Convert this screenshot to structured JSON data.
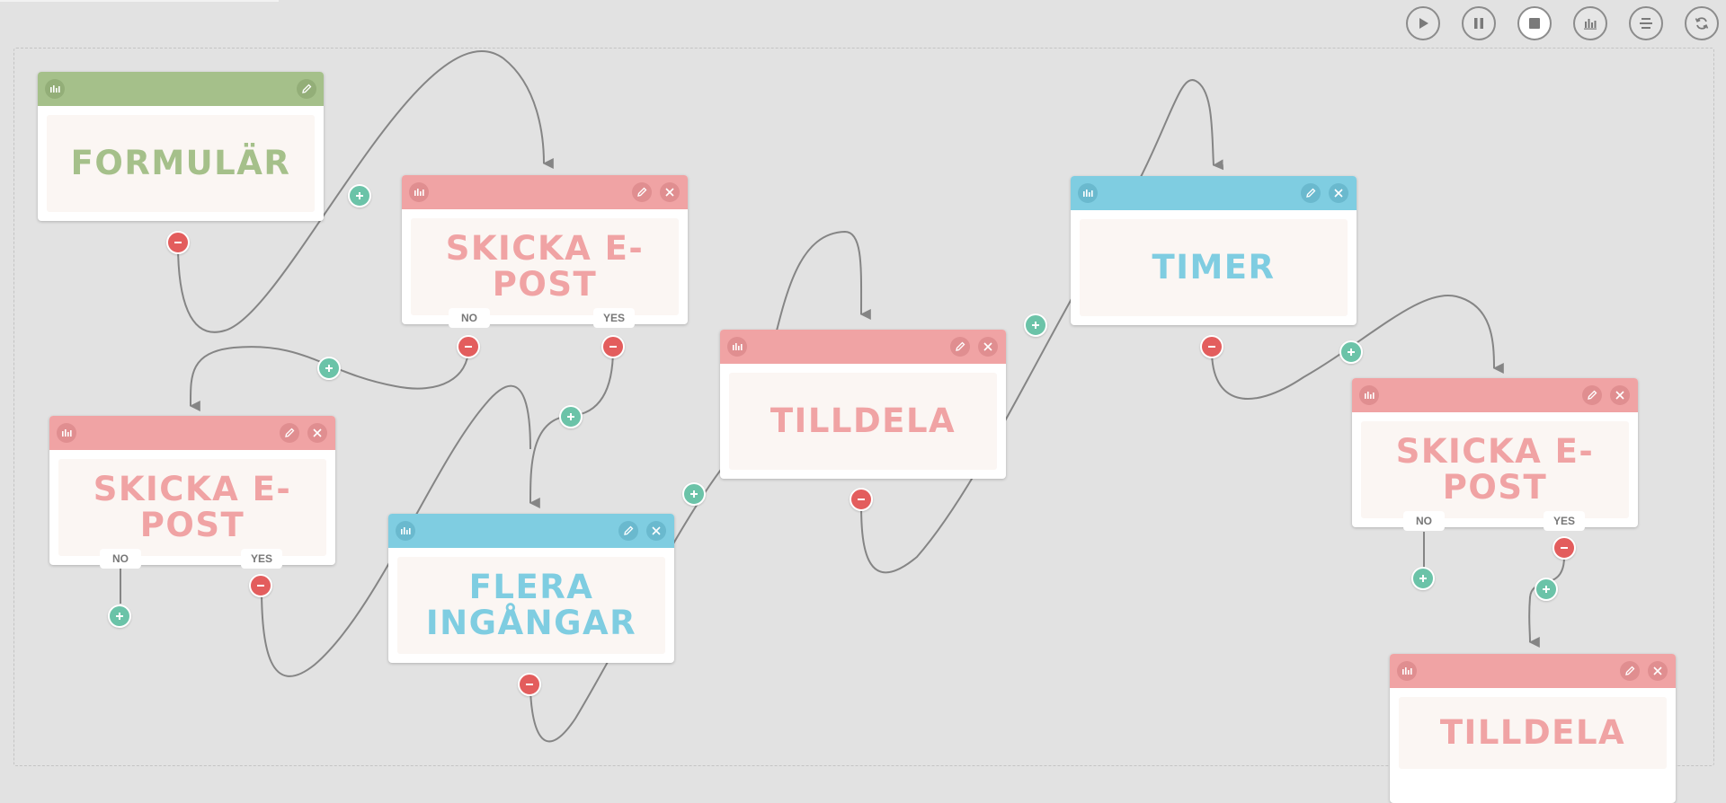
{
  "toolbar": {
    "buttons": [
      {
        "name": "play-button",
        "icon": "play-icon",
        "active": false
      },
      {
        "name": "pause-button",
        "icon": "pause-icon",
        "active": false
      },
      {
        "name": "stop-button",
        "icon": "stop-icon",
        "active": true
      },
      {
        "name": "stats-button",
        "icon": "bar-chart-icon",
        "active": false
      },
      {
        "name": "align-button",
        "icon": "align-center-icon",
        "active": false
      },
      {
        "name": "refresh-button",
        "icon": "refresh-icon",
        "active": false
      }
    ]
  },
  "colors": {
    "green": "#a5c08a",
    "red": "#f0a3a4",
    "blue": "#7fcde1",
    "minus": "#e35d5d",
    "plus": "#6bc3a8",
    "edge": "#858585",
    "background": "#e2e2e2"
  },
  "nodes": [
    {
      "id": "formular",
      "title": "FORMULÄR",
      "color": "green",
      "has_close": false
    },
    {
      "id": "send-email-1",
      "title": "SKICKA E-POST",
      "color": "red",
      "has_close": true,
      "branch_no": "NO",
      "branch_yes": "YES"
    },
    {
      "id": "send-email-2",
      "title": "SKICKA E-POST",
      "color": "red",
      "has_close": true,
      "branch_no": "NO",
      "branch_yes": "YES"
    },
    {
      "id": "multiple-inputs",
      "title_line1": "FLERA",
      "title_line2": "INGÅNGAR",
      "color": "blue",
      "has_close": true
    },
    {
      "id": "assign-1",
      "title": "TILLDELA",
      "color": "red",
      "has_close": true
    },
    {
      "id": "timer",
      "title": "TIMER",
      "color": "blue",
      "has_close": true
    },
    {
      "id": "send-email-3",
      "title": "SKICKA E-POST",
      "color": "red",
      "has_close": true,
      "branch_no": "NO",
      "branch_yes": "YES"
    },
    {
      "id": "assign-2",
      "title": "TILLDELA",
      "color": "red",
      "has_close": true
    }
  ]
}
